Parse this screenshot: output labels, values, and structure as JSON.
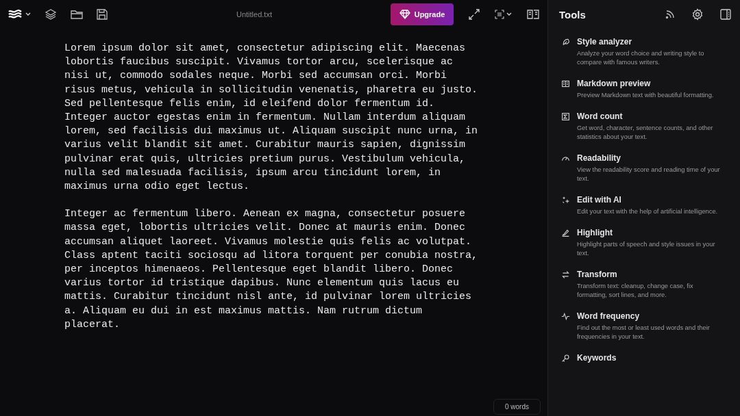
{
  "document": {
    "title": "Untitled.txt",
    "paragraphs": [
      "Lorem ipsum dolor sit amet, consectetur adipiscing elit. Maecenas lobortis faucibus suscipit. Vivamus tortor arcu, scelerisque ac nisi ut, commodo sodales neque. Morbi sed accumsan orci. Morbi risus metus, vehicula in sollicitudin venenatis, pharetra eu justo. Sed pellentesque felis enim, id eleifend dolor fermentum id. Integer auctor egestas enim in fermentum. Nullam interdum aliquam lorem, sed facilisis dui maximus ut. Aliquam suscipit nunc urna, in varius velit blandit sit amet. Curabitur mauris sapien, dignissim pulvinar erat quis, ultricies pretium purus. Vestibulum vehicula, nulla sed malesuada facilisis, ipsum arcu tincidunt lorem, in maximus urna odio eget lectus.",
      "Integer ac fermentum libero. Aenean ex magna, consectetur posuere massa eget, lobortis ultricies velit. Donec at mauris enim. Donec accumsan aliquet laoreet. Vivamus molestie quis felis ac volutpat. Class aptent taciti sociosqu ad litora torquent per conubia nostra, per inceptos himenaeos. Pellentesque eget blandit libero. Donec varius tortor id tristique dapibus. Nunc elementum quis lacus eu mattis. Curabitur tincidunt nisl ante, id pulvinar lorem ultricies a. Aliquam eu dui in est maximus mattis. Nam rutrum dictum placerat."
    ]
  },
  "upgrade_button": {
    "label": "Upgrade"
  },
  "word_count": "0 words",
  "tools_panel": {
    "title": "Tools",
    "items": [
      {
        "kind": "feather",
        "title": "Style analyzer",
        "description": "Analyze your word choice and writing style to compare with famous writers."
      },
      {
        "kind": "book",
        "title": "Markdown preview",
        "description": "Preview Markdown text with beautiful formatting."
      },
      {
        "kind": "sigma",
        "title": "Word count",
        "description": "Get word, character, sentence counts, and other statistics about your text."
      },
      {
        "kind": "gauge",
        "title": "Readability",
        "description": "View the readability score and reading time of your text."
      },
      {
        "kind": "sparkles",
        "title": "Edit with AI",
        "description": "Edit your text with the help of artificial intelligence."
      },
      {
        "kind": "pen",
        "title": "Highlight",
        "description": "Highlight parts of speech and style issues in your text."
      },
      {
        "kind": "arrows",
        "title": "Transform",
        "description": "Transform text: cleanup, change case, fix formatting, sort lines, and more."
      },
      {
        "kind": "pulse",
        "title": "Word frequency",
        "description": "Find out the most or least used words and their frequencies in your text."
      },
      {
        "kind": "key",
        "title": "Keywords"
      }
    ]
  }
}
